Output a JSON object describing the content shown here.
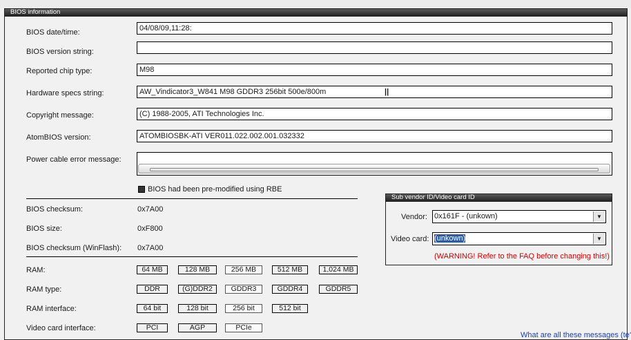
{
  "window": {
    "title": "BIOS information"
  },
  "fields": {
    "bios_date_label": "BIOS date/time:",
    "bios_date": "04/08/09,11:28:",
    "version_label": "BIOS version string:",
    "version": "",
    "chip_label": "Reported chip type:",
    "chip": "M98",
    "hw_label": "Hardware specs string:",
    "hw": "AW_Vindicator3_W841 M98 GDDR3 256bit 500e/800m",
    "copyright_label": "Copyright message:",
    "copyright": "(C) 1988-2005, ATI Technologies Inc.",
    "atom_label": "AtomBIOS version:",
    "atom": "ATOMBIOSBK-ATI VER011.022.002.001.032332",
    "power_label": "Power cable error message:",
    "power": ""
  },
  "premod": {
    "label": "BIOS had been pre-modified using RBE",
    "checked": true
  },
  "checksum": {
    "checksum_label": "BIOS checksum:",
    "checksum": "0x7A00",
    "size_label": "BIOS size:",
    "size": "0xF800",
    "winflash_label": "BIOS checksum (WinFlash):",
    "winflash": "0x7A00"
  },
  "ram": {
    "size_label": "RAM:",
    "sizes": [
      "64 MB",
      "128 MB",
      "256 MB",
      "512 MB",
      "1,024 MB"
    ],
    "type_label": "RAM type:",
    "types": [
      "DDR",
      "(G)DDR2",
      "GDDR3",
      "GDDR4",
      "GDDR5"
    ],
    "iface_label": "RAM interface:",
    "ifaces": [
      "64 bit",
      "128 bit",
      "256 bit",
      "512 bit"
    ],
    "card_label": "Video card interface:",
    "cards": [
      "PCI",
      "AGP",
      "PCIe"
    ]
  },
  "subvendor": {
    "title": "Sub vendor ID/Video card ID",
    "vendor_label": "Vendor:",
    "vendor": "0x161F - (unkown)",
    "card_label": "Video card:",
    "card": "(unkown)",
    "warning": "(WARNING! Refer to the FAQ before changing this!)"
  },
  "footer": {
    "link": "What are all these messages (te?"
  },
  "colors": {
    "warning": "#d40000",
    "titlebar": "#2a2a2a",
    "selection": "#2d5ba8"
  }
}
